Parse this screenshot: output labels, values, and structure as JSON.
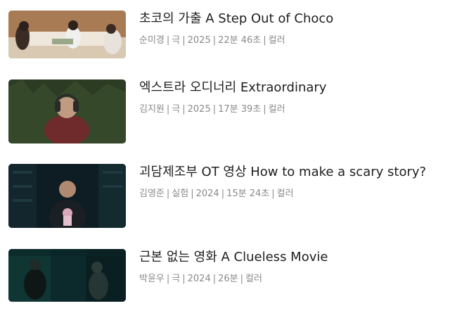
{
  "films": [
    {
      "title": "초코의 가출 A Step Out of Choco",
      "director": "순미경",
      "genre": "극",
      "year": "2025",
      "runtime": "22분 46초",
      "color": "컬러"
    },
    {
      "title": "엑스트라 오디너리 Extraordinary",
      "director": "김지원",
      "genre": "극",
      "year": "2025",
      "runtime": "17분 39초",
      "color": "컬러"
    },
    {
      "title": "괴담제조부 OT 영상 How to make a scary story?",
      "director": "김영준",
      "genre": "실험",
      "year": "2024",
      "runtime": "15분 24초",
      "color": "컬러"
    },
    {
      "title": "근본 없는 영화 A Clueless Movie",
      "director": "박윤우",
      "genre": "극",
      "year": "2024",
      "runtime": "26분",
      "color": "컬러"
    }
  ],
  "separator": "|"
}
